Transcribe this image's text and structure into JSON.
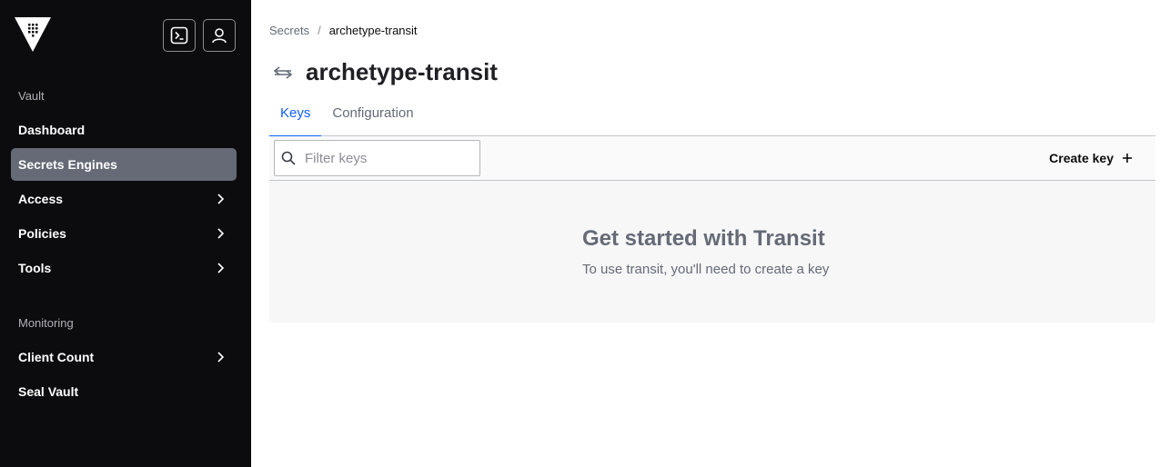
{
  "sidebar": {
    "sections": [
      {
        "label": "Vault"
      },
      {
        "label": "Monitoring"
      }
    ],
    "items": [
      {
        "label": "Dashboard"
      },
      {
        "label": "Secrets Engines"
      },
      {
        "label": "Access"
      },
      {
        "label": "Policies"
      },
      {
        "label": "Tools"
      },
      {
        "label": "Client Count"
      },
      {
        "label": "Seal Vault"
      }
    ]
  },
  "breadcrumb": {
    "parent": "Secrets",
    "separator": "/",
    "current": "archetype-transit"
  },
  "header": {
    "title": "archetype-transit"
  },
  "tabs": [
    {
      "label": "Keys"
    },
    {
      "label": "Configuration"
    }
  ],
  "toolbar": {
    "filter_placeholder": "Filter keys",
    "create_label": "Create key"
  },
  "empty_state": {
    "title": "Get started with Transit",
    "message": "To use transit, you'll need to create a key"
  },
  "colors": {
    "sidebar_bg": "#0c0c0e",
    "active_item": "#656a76",
    "accent": "#1060ff"
  }
}
